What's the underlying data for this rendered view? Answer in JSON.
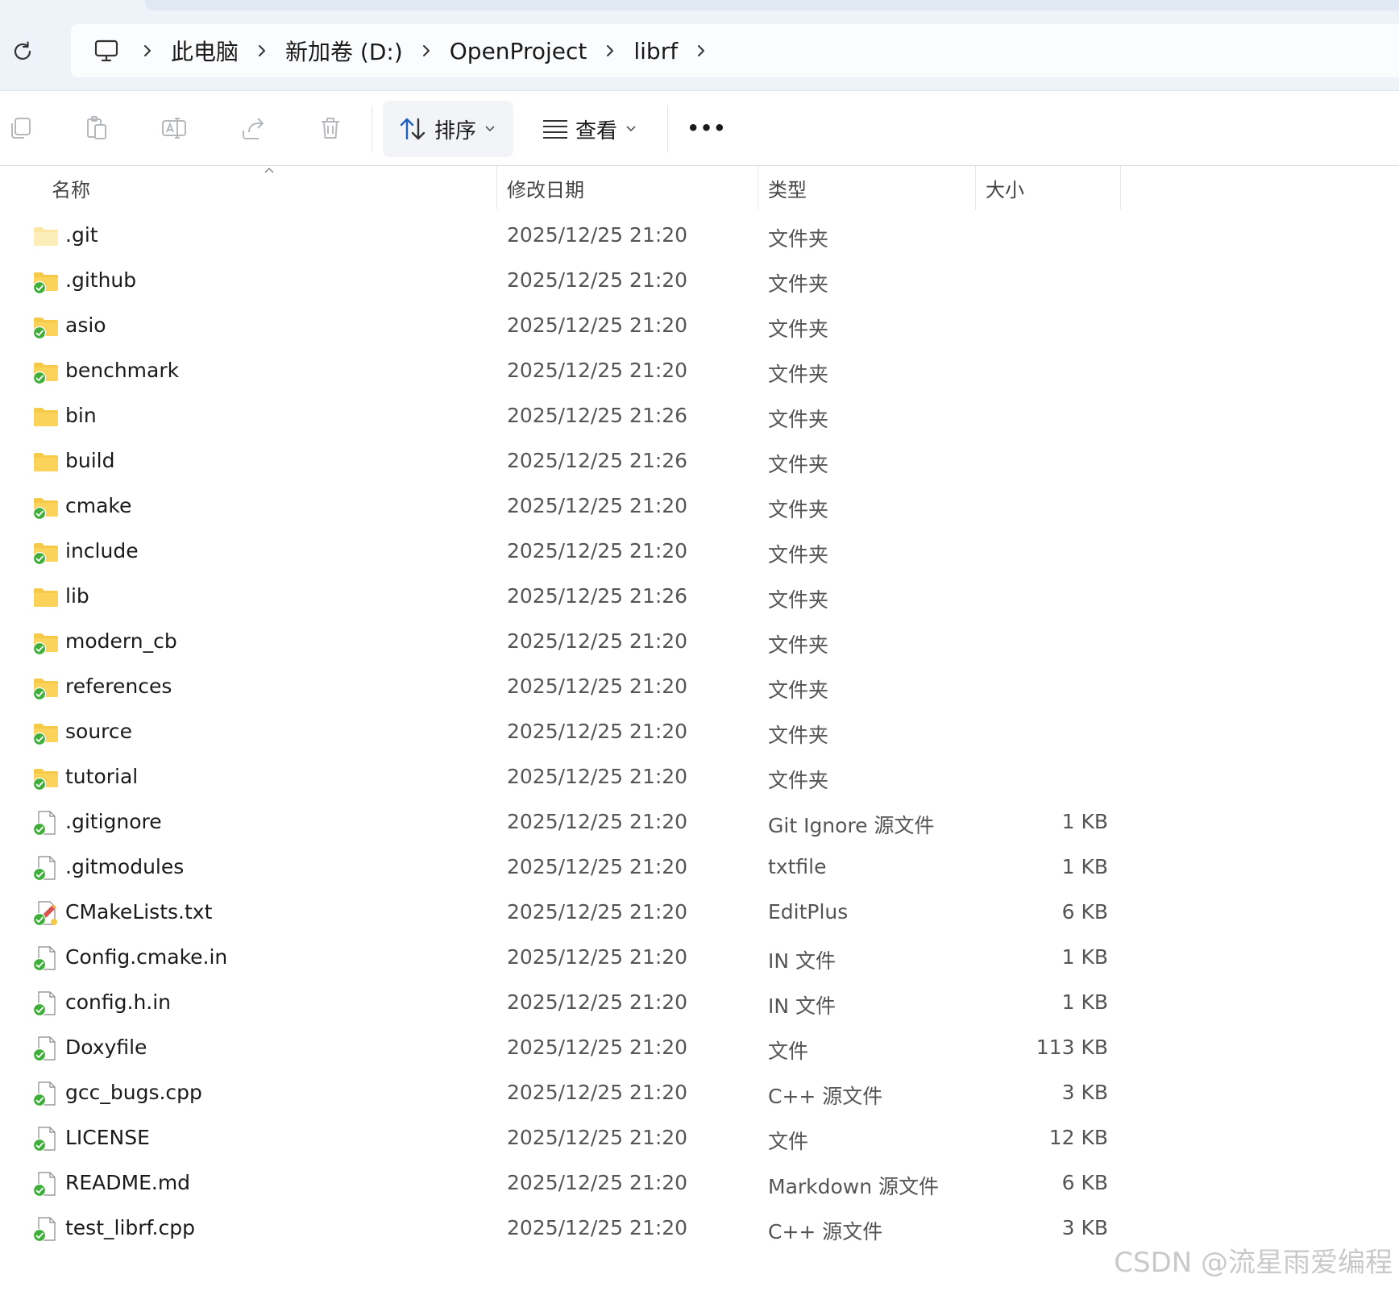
{
  "breadcrumb": {
    "pc_icon": "computer-icon",
    "items": [
      "此电脑",
      "新加卷 (D:)",
      "OpenProject",
      "librf"
    ]
  },
  "toolbar": {
    "sort_label": "排序",
    "view_label": "查看",
    "more_label": "•••"
  },
  "columns": {
    "name": "名称",
    "modified": "修改日期",
    "type": "类型",
    "size": "大小"
  },
  "colors": {
    "folder_yellow": "#f7c948",
    "sync_green": "#3fae3a",
    "accent_blue": "#1f5fbf"
  },
  "files": [
    {
      "name": ".git",
      "modified": "2025/12/25 21:20",
      "type": "文件夹",
      "size": "",
      "kind": "folder-plain-light"
    },
    {
      "name": ".github",
      "modified": "2025/12/25 21:20",
      "type": "文件夹",
      "size": "",
      "kind": "folder-synced"
    },
    {
      "name": "asio",
      "modified": "2025/12/25 21:20",
      "type": "文件夹",
      "size": "",
      "kind": "folder-synced"
    },
    {
      "name": "benchmark",
      "modified": "2025/12/25 21:20",
      "type": "文件夹",
      "size": "",
      "kind": "folder-synced"
    },
    {
      "name": "bin",
      "modified": "2025/12/25 21:26",
      "type": "文件夹",
      "size": "",
      "kind": "folder-plain"
    },
    {
      "name": "build",
      "modified": "2025/12/25 21:26",
      "type": "文件夹",
      "size": "",
      "kind": "folder-plain"
    },
    {
      "name": "cmake",
      "modified": "2025/12/25 21:20",
      "type": "文件夹",
      "size": "",
      "kind": "folder-synced"
    },
    {
      "name": "include",
      "modified": "2025/12/25 21:20",
      "type": "文件夹",
      "size": "",
      "kind": "folder-synced"
    },
    {
      "name": "lib",
      "modified": "2025/12/25 21:26",
      "type": "文件夹",
      "size": "",
      "kind": "folder-plain"
    },
    {
      "name": "modern_cb",
      "modified": "2025/12/25 21:20",
      "type": "文件夹",
      "size": "",
      "kind": "folder-synced"
    },
    {
      "name": "references",
      "modified": "2025/12/25 21:20",
      "type": "文件夹",
      "size": "",
      "kind": "folder-synced"
    },
    {
      "name": "source",
      "modified": "2025/12/25 21:20",
      "type": "文件夹",
      "size": "",
      "kind": "folder-synced"
    },
    {
      "name": "tutorial",
      "modified": "2025/12/25 21:20",
      "type": "文件夹",
      "size": "",
      "kind": "folder-synced"
    },
    {
      "name": ".gitignore",
      "modified": "2025/12/25 21:20",
      "type": "Git Ignore 源文件",
      "size": "1 KB",
      "kind": "file-synced"
    },
    {
      "name": ".gitmodules",
      "modified": "2025/12/25 21:20",
      "type": "txtfile",
      "size": "1 KB",
      "kind": "file-synced"
    },
    {
      "name": "CMakeLists.txt",
      "modified": "2025/12/25 21:20",
      "type": "EditPlus",
      "size": "6 KB",
      "kind": "editplus-synced"
    },
    {
      "name": "Config.cmake.in",
      "modified": "2025/12/25 21:20",
      "type": "IN 文件",
      "size": "1 KB",
      "kind": "file-synced"
    },
    {
      "name": "config.h.in",
      "modified": "2025/12/25 21:20",
      "type": "IN 文件",
      "size": "1 KB",
      "kind": "file-synced"
    },
    {
      "name": "Doxyfile",
      "modified": "2025/12/25 21:20",
      "type": "文件",
      "size": "113 KB",
      "kind": "file-synced"
    },
    {
      "name": "gcc_bugs.cpp",
      "modified": "2025/12/25 21:20",
      "type": "C++ 源文件",
      "size": "3 KB",
      "kind": "file-synced"
    },
    {
      "name": "LICENSE",
      "modified": "2025/12/25 21:20",
      "type": "文件",
      "size": "12 KB",
      "kind": "file-synced"
    },
    {
      "name": "README.md",
      "modified": "2025/12/25 21:20",
      "type": "Markdown 源文件",
      "size": "6 KB",
      "kind": "file-synced"
    },
    {
      "name": "test_librf.cpp",
      "modified": "2025/12/25 21:20",
      "type": "C++ 源文件",
      "size": "3 KB",
      "kind": "file-synced"
    }
  ],
  "watermark": "CSDN @流星雨爱编程"
}
